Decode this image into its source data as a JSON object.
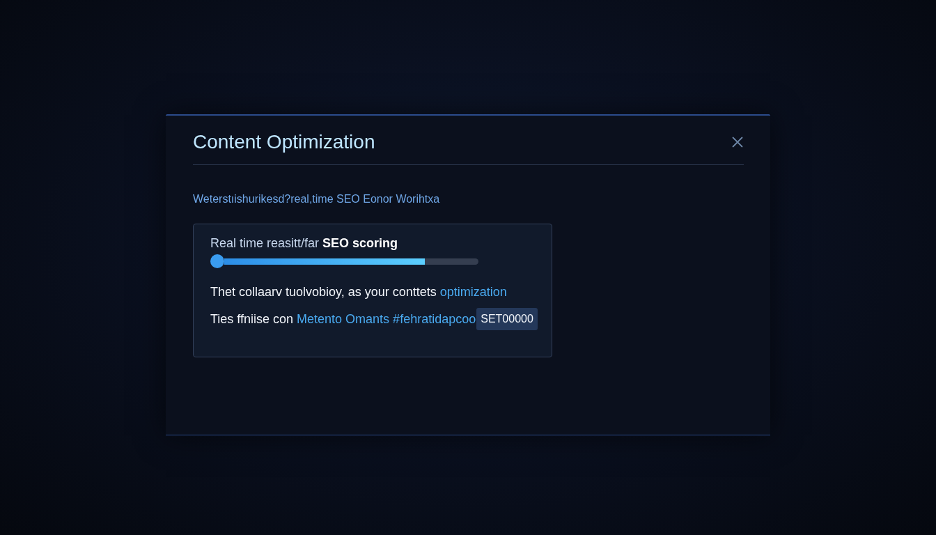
{
  "dialog": {
    "title": "Content Optimization",
    "subtitle": "Weterstıishurikesd?real,time SEO Eonor Worihtxa",
    "card": {
      "heading": "Real time reasitt/far **SEO scoring**",
      "score": {
        "level": 0.79
      },
      "lines": [
        [
          {
            "kind": "plain",
            "text": "Thet collaarv tuolvobioy, as your conttets"
          },
          {
            "kind": "link",
            "text": "optimization"
          }
        ],
        [
          {
            "kind": "plain",
            "text": "Ties ffniise con"
          },
          {
            "kind": "link",
            "text": "Metento Omants #fehratidapcoo"
          },
          {
            "kind": "tag",
            "text": "SET00000"
          }
        ]
      ]
    }
  }
}
